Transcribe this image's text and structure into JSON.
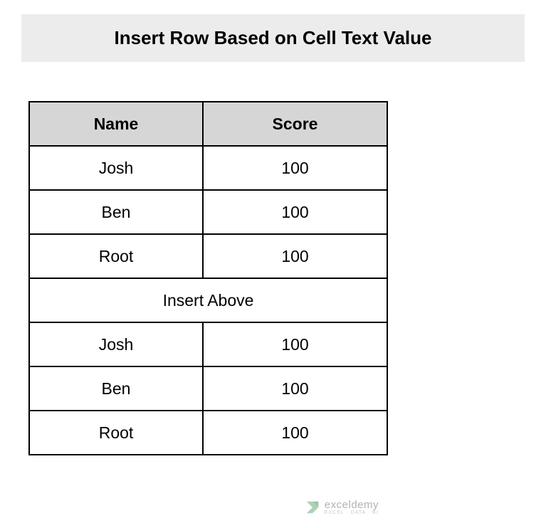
{
  "title": "Insert Row Based on Cell Text Value",
  "table": {
    "headers": {
      "name": "Name",
      "score": "Score"
    },
    "rows": [
      {
        "name": "Josh",
        "score": "100"
      },
      {
        "name": "Ben",
        "score": "100"
      },
      {
        "name": "Root",
        "score": "100"
      }
    ],
    "insert_label": "Insert Above",
    "rows2": [
      {
        "name": "Josh",
        "score": "100"
      },
      {
        "name": "Ben",
        "score": "100"
      },
      {
        "name": "Root",
        "score": "100"
      }
    ]
  },
  "watermark": {
    "main": "exceldemy",
    "sub": "EXCEL · DATA · BI"
  }
}
